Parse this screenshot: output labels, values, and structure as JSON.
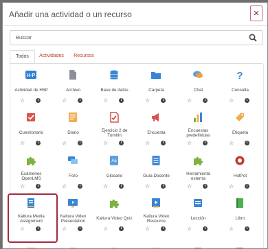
{
  "modal": {
    "title": "Añadir una actividad o un recurso",
    "close_glyph": "×"
  },
  "search": {
    "placeholder": "Buscar"
  },
  "tabs": [
    {
      "label": "Todos",
      "active": true
    },
    {
      "label": "Actividades",
      "active": false
    },
    {
      "label": "Recursos",
      "active": false
    }
  ],
  "tiles": [
    {
      "label": "Actividad de H5P",
      "icon": "h5p-icon"
    },
    {
      "label": "Archivo",
      "icon": "file-icon"
    },
    {
      "label": "Base de datos",
      "icon": "database-icon"
    },
    {
      "label": "Carpeta",
      "icon": "folder-icon"
    },
    {
      "label": "Chat",
      "icon": "chat-icon"
    },
    {
      "label": "Consulta",
      "icon": "question-icon"
    },
    {
      "label": "Cuestionario",
      "icon": "quiz-icon"
    },
    {
      "label": "Diario",
      "icon": "journal-icon"
    },
    {
      "label": "Ejercicio 2 de Turnitin",
      "icon": "turnitin-icon"
    },
    {
      "label": "Encuesta",
      "icon": "megaphone-icon"
    },
    {
      "label": "Encuestas predefinidas",
      "icon": "survey-chart-icon"
    },
    {
      "label": "Etiqueta",
      "icon": "tag-icon"
    },
    {
      "label": "Exámenes OpenLMS",
      "icon": "puzzle-icon"
    },
    {
      "label": "Foro",
      "icon": "forum-icon"
    },
    {
      "label": "Glosario",
      "icon": "glossary-icon"
    },
    {
      "label": "Guía Docente",
      "icon": "guide-icon"
    },
    {
      "label": "Herramienta externa",
      "icon": "puzzle-icon"
    },
    {
      "label": "HotPot",
      "icon": "hotpot-icon"
    },
    {
      "label": "Kaltura Media Assignment",
      "icon": "kaltura-assignment-icon"
    },
    {
      "label": "Kaltura Video Presentation",
      "icon": "kaltura-presentation-icon"
    },
    {
      "label": "Kaltura Video Quiz",
      "icon": "puzzle-icon"
    },
    {
      "label": "Kaltura Video Resource",
      "icon": "kaltura-resource-icon"
    },
    {
      "label": "Lección",
      "icon": "lesson-icon"
    },
    {
      "label": "Libro",
      "icon": "book-icon"
    }
  ],
  "partial_row_icons": [
    "partial-icon-1",
    "partial-icon-2",
    "partial-icon-3",
    "partial-icon-4",
    "partial-icon-5",
    "partial-icon-6"
  ],
  "star_glyph": "☆",
  "info_glyph": "i",
  "colors": {
    "link_red": "#c0392b",
    "highlight": "#a32a3f",
    "puzzle_green": "#7cb342",
    "blue": "#3a86d6"
  }
}
